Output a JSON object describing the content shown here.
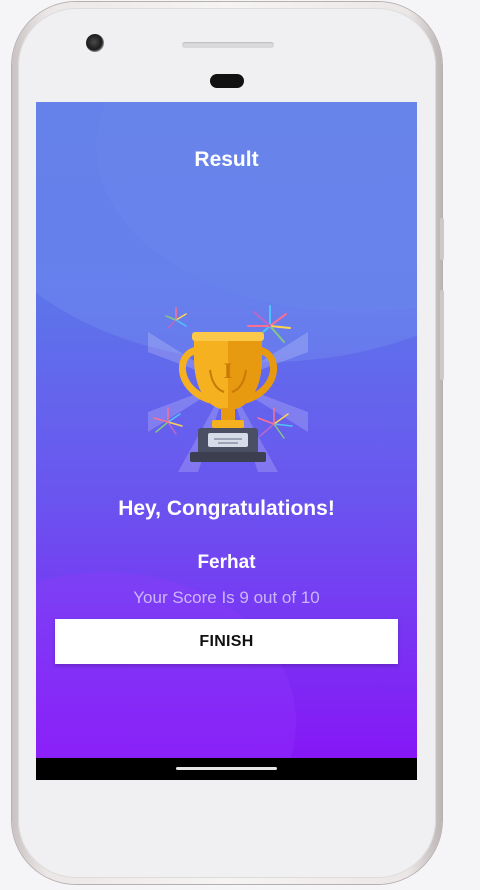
{
  "screen": {
    "title": "Result",
    "congrats_text": "Hey, Congratulations!",
    "user_name": "Ferhat",
    "score_text": "Your Score Is 9 out of 10",
    "finish_button_label": "FINISH"
  },
  "illustration": {
    "icon": "trophy-icon",
    "trophy_rank_label": "I",
    "decorations": "fireworks"
  },
  "colors": {
    "gradient_top": "#5b78e6",
    "gradient_bottom": "#8617f6",
    "button_bg": "#ffffff",
    "trophy_gold": "#f5b120"
  }
}
